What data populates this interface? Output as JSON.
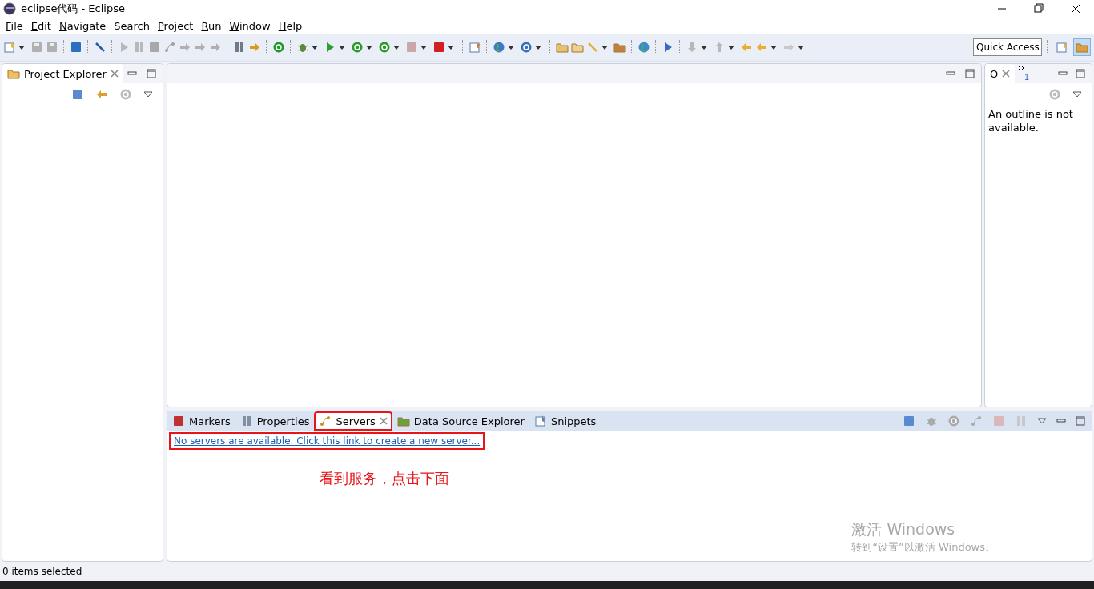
{
  "window": {
    "title": "eclipse代码 - Eclipse"
  },
  "menu": [
    {
      "mnemonic": "F",
      "rest": "ile"
    },
    {
      "mnemonic": "E",
      "rest": "dit"
    },
    {
      "mnemonic": "N",
      "rest": "avigate"
    },
    {
      "rest": "Search"
    },
    {
      "mnemonic": "P",
      "rest": "roject"
    },
    {
      "mnemonic": "R",
      "rest": "un"
    },
    {
      "mnemonic": "W",
      "rest": "indow"
    },
    {
      "mnemonic": "H",
      "rest": "elp"
    }
  ],
  "toolbar": {
    "quick_access": {
      "placeholder": "Quick Access"
    }
  },
  "project_explorer": {
    "tab": {
      "label": "Project Explorer",
      "selected": true
    }
  },
  "outline": {
    "tab": {
      "label": "O",
      "selected": true
    },
    "overflow_count": "1",
    "message": "An outline is not available."
  },
  "bottom_panel": {
    "tabs": [
      {
        "label": "Markers",
        "selected": false,
        "highlighted": false
      },
      {
        "label": "Properties",
        "selected": false,
        "highlighted": false
      },
      {
        "label": "Servers",
        "selected": true,
        "highlighted": true
      },
      {
        "label": "Data Source Explorer",
        "selected": false,
        "highlighted": false
      },
      {
        "label": "Snippets",
        "selected": false,
        "highlighted": false
      }
    ],
    "link": {
      "text": "No servers are available. Click this link to create a new server...",
      "highlighted": true
    },
    "annotation": "看到服务，点击下面"
  },
  "activation": {
    "title": "激活 Windows",
    "subtitle": "转到“设置”以激活 Windows。"
  },
  "status_bar": {
    "text": "0 items selected"
  }
}
